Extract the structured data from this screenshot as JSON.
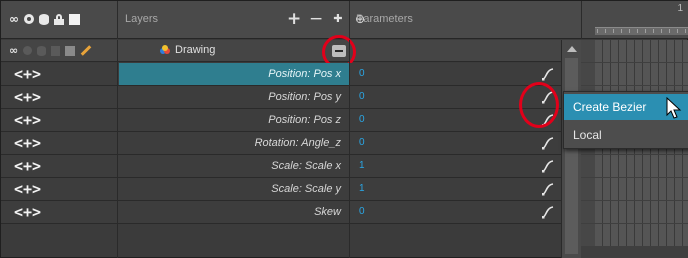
{
  "header": {
    "layers_label": "Layers",
    "parameters_label": "Parameters",
    "frame_number": "1",
    "left_icons": [
      "onion-skin-icon",
      "visibility-icon",
      "database-icon",
      "lock-icon",
      "color-swatch-icon"
    ],
    "tools": [
      "add-layer-icon",
      "remove-layer-icon",
      "add-peg-icon",
      "add-drawing-layer-icon"
    ]
  },
  "drawing": {
    "name": "Drawing",
    "icons": [
      "onion-skin-icon",
      "visibility-icon",
      "database-icon",
      "lock-icon",
      "color-swatch-icon",
      "pencil-icon"
    ]
  },
  "arrows_glyph": "<+>",
  "rows": [
    {
      "name": "Position: Pos x",
      "value": "0",
      "selected": true
    },
    {
      "name": "Position: Pos y",
      "value": "0",
      "selected": false
    },
    {
      "name": "Position: Pos z",
      "value": "0",
      "selected": false
    },
    {
      "name": "Rotation: Angle_z",
      "value": "0",
      "selected": false
    },
    {
      "name": "Scale: Scale x",
      "value": "1",
      "selected": false
    },
    {
      "name": "Scale: Scale y",
      "value": "1",
      "selected": false
    },
    {
      "name": "Skew",
      "value": "0",
      "selected": false
    }
  ],
  "context_menu": {
    "items": [
      "Create Bezier",
      "Local"
    ],
    "highlighted_index": 0
  },
  "colors": {
    "selection": "#2f7e8f",
    "value_text": "#2aa7e6",
    "menu_highlight": "#2b8fb2",
    "annotation_circle": "#e2001a"
  }
}
